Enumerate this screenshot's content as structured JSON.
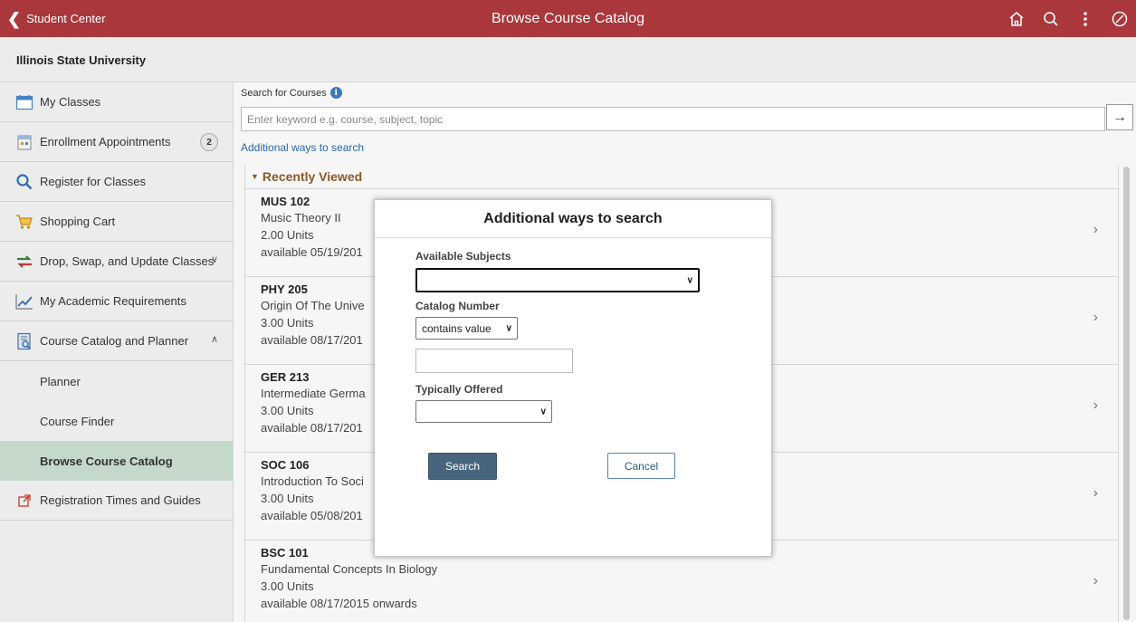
{
  "banner": {
    "back_label": "Student Center",
    "title": "Browse Course Catalog",
    "icons": [
      "home-icon",
      "search-icon",
      "more-vertical-icon",
      "compass-icon"
    ],
    "color": "#a9373c"
  },
  "institution": "Illinois State University",
  "sidebar": {
    "items": [
      {
        "label": "My Classes",
        "icon": "calendar-icon"
      },
      {
        "label": "Enrollment Appointments",
        "icon": "appointment-calendar-icon",
        "badge": "2"
      },
      {
        "label": "Register for Classes",
        "icon": "magnifier-icon"
      },
      {
        "label": "Shopping Cart",
        "icon": "shopping-cart-icon"
      },
      {
        "label": "Drop, Swap, and Update Classes",
        "icon": "swap-arrows-icon",
        "expanded": false
      },
      {
        "label": "My Academic Requirements",
        "icon": "line-chart-icon"
      },
      {
        "label": "Course Catalog and Planner",
        "icon": "catalog-book-icon",
        "expanded": true
      }
    ],
    "subitems": [
      "Planner",
      "Course Finder",
      "Browse Course Catalog"
    ],
    "active_subitem": "Browse Course Catalog",
    "external_item": {
      "label": "Registration Times and Guides",
      "icon": "external-link-icon"
    }
  },
  "search": {
    "label": "Search for Courses",
    "placeholder": "Enter keyword e.g. course, subject, topic",
    "additional_link": "Additional ways to search"
  },
  "recently_viewed": {
    "header": "Recently Viewed",
    "courses": [
      {
        "code": "MUS 102",
        "title": "Music Theory II",
        "units": "2.00 Units",
        "available": "available 05/19/201"
      },
      {
        "code": "PHY 205",
        "title": "Origin Of The Unive",
        "units": "3.00 Units",
        "available": "available 08/17/201"
      },
      {
        "code": "GER 213",
        "title": "Intermediate Germa",
        "units": "3.00 Units",
        "available": "available 08/17/201"
      },
      {
        "code": "SOC 106",
        "title": "Introduction To Soci",
        "units": "3.00 Units",
        "available": "available 05/08/201"
      },
      {
        "code": "BSC 101",
        "title": "Fundamental Concepts In Biology",
        "units": "3.00 Units",
        "available": "available 08/17/2015 onwards"
      }
    ]
  },
  "modal": {
    "title": "Additional ways to search",
    "available_subjects_label": "Available Subjects",
    "available_subjects_value": "",
    "catalog_number_label": "Catalog Number",
    "catalog_number_operator": "contains value",
    "catalog_number_value": "",
    "typically_offered_label": "Typically Offered",
    "typically_offered_value": "",
    "search_button": "Search",
    "cancel_button": "Cancel"
  }
}
